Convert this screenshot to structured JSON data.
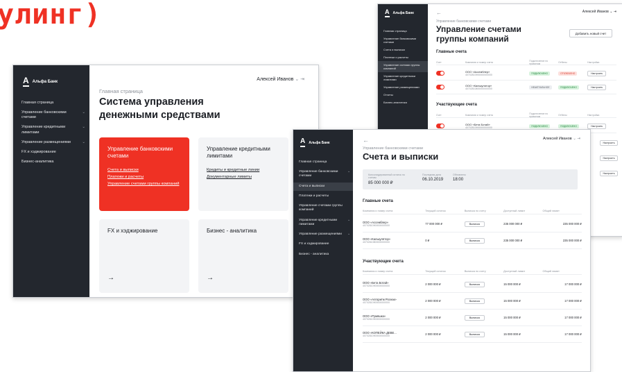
{
  "brand_text": "улинг)",
  "colors": {
    "accent": "#ef3124",
    "sidebar": "#23272e",
    "tile": "#f3f4f6"
  },
  "screen1": {
    "logo": "Альфа Банк",
    "nav": [
      {
        "label": "Главная страница",
        "chevron": false
      },
      {
        "label": "Управление банковскими счетами",
        "chevron": true
      },
      {
        "label": "Управление кредитными лимитами",
        "chevron": true
      },
      {
        "label": "Управление размещениями",
        "chevron": true
      },
      {
        "label": "FX и хэджирование",
        "chevron": false
      },
      {
        "label": "Бизнес-аналитика",
        "chevron": false
      }
    ],
    "user": "Алексей Иванов",
    "breadcrumb": "Главная страница",
    "title": "Система управления денежными средствами",
    "tiles": [
      {
        "title": "Управление банковскими счетами",
        "links": [
          "Счета и выписки",
          "Платежи и расчеты",
          "Управление счетами группы компаний"
        ]
      },
      {
        "title": "Управление кредитными лимитами",
        "links": [
          "Кредиты и кредитные линии",
          "Документарные лимиты"
        ]
      },
      {
        "title": "FX и хэджирование",
        "links": []
      },
      {
        "title": "Бизнес - аналитика",
        "links": []
      }
    ],
    "arrow": "→"
  },
  "screen2": {
    "logo": "Альфа Банк",
    "nav": [
      "Главная страница",
      "Управление банковскими счетами",
      "Счета и выписки",
      "Платежи и расчеты",
      "Управление счетами группы компаний",
      "Управление кредитными лимитами",
      "Управление размещениями",
      "Отчеты",
      "Бизнес-аналитика"
    ],
    "user": "Алексей Иванов",
    "breadcrumb": "Управление банковскими счетами",
    "title": "Управление счетами группы компаний",
    "add_button": "Добавить новый счет",
    "main_title": "Главные счета",
    "headers": [
      "Счет",
      "Компания и номер счета",
      "Подключение по правилам",
      "Отбелы",
      "Настройка"
    ],
    "main_rows": [
      {
        "name": "ООО «Ассемблер»",
        "acc": "40702810900000000000",
        "c1": "ПОДКЛЮЧЕНО",
        "c1t": "g",
        "c2": "ОТКЛЮЧЕНО",
        "c2t": "r",
        "btn": "Настроить"
      },
      {
        "name": "ООО «Калькулятор»",
        "acc": "40702810800000000000",
        "c1": "НЕАКТУАЛЬНОЕ",
        "c1t": "gray",
        "c2": "ПОДКЛЮЧЕНО",
        "c2t": "g",
        "btn": "Настроить"
      }
    ],
    "sub_title": "Участвующие счета",
    "sub_rows": [
      {
        "name": "ООО «Бета Ботай»",
        "acc": "40702810900000000000",
        "c1": "ПОДКЛЮЧЕНО",
        "c1t": "g",
        "c2": "ПОДКЛЮЧЕНО",
        "c2t": "g",
        "btn": "Настроить"
      }
    ],
    "extra_buttons": [
      "Настроить",
      "Настроить",
      "Настроить"
    ]
  },
  "screen3": {
    "logo": "Альфа Банк",
    "nav": [
      "Главная страница",
      "Управление банковскими счетами",
      "Счета и выписки",
      "Платежи и расчеты",
      "Управление счетами группы компаний",
      "Управление кредитными лимитами",
      "Управление размещениями",
      "FX и хэджирование",
      "Бизнес - аналитика"
    ],
    "back": "←",
    "user": "Алексей Иванов",
    "breadcrumb": "Управление банковскими счетами",
    "title": "Счета и выписки",
    "summary": [
      {
        "label": "Консолидированный остаток по счетам",
        "value": "85 000 000 ₽"
      },
      {
        "label": "Последняя дата",
        "value": "06.10.2019"
      },
      {
        "label": "Обновлено",
        "value": "18:00"
      }
    ],
    "main_title": "Главные счета",
    "headers": [
      "Компания и номер счета",
      "Текущий остаток",
      "Выписка по счету",
      "Доступный лимит",
      "Общий лимит"
    ],
    "main_rows": [
      {
        "name": "ООО «Ассемблер»",
        "acc": "40702810900000000000",
        "balance": "77 000 000 ₽",
        "btn": "Выписка",
        "avail": "235 000 000 ₽",
        "total": "235 000 000 ₽"
      },
      {
        "name": "ООО «Калькулятор»",
        "acc": "40702810800000000000",
        "balance": "0 ₽",
        "btn": "Выписка",
        "avail": "235 000 000 ₽",
        "total": "235 000 000 ₽"
      }
    ],
    "sub_title": "Участвующие счета",
    "sub_rows": [
      {
        "name": "ООО «Бета Ботай»",
        "acc": "40702810900000000000",
        "balance": "2 000 000 ₽",
        "btn": "Выписка",
        "avail": "15 000 000 ₽",
        "total": "17 000 000 ₽"
      },
      {
        "name": "ООО «Алгоритм Роснак»",
        "acc": "40702810900000000000",
        "balance": "2 000 000 ₽",
        "btn": "Выписка",
        "avail": "15 000 000 ₽",
        "total": "17 000 000 ₽"
      },
      {
        "name": "ООО «Румяшка»",
        "acc": "40702810900000000000",
        "balance": "2 000 000 ₽",
        "btn": "Выписка",
        "avail": "15 000 000 ₽",
        "total": "17 000 000 ₽"
      },
      {
        "name": "ООО «КОПЕЙКА ДЕВЕ...",
        "acc": "40702810900000000000",
        "balance": "2 000 000 ₽",
        "btn": "Выписка",
        "avail": "15 000 000 ₽",
        "total": "17 000 000 ₽"
      }
    ]
  }
}
